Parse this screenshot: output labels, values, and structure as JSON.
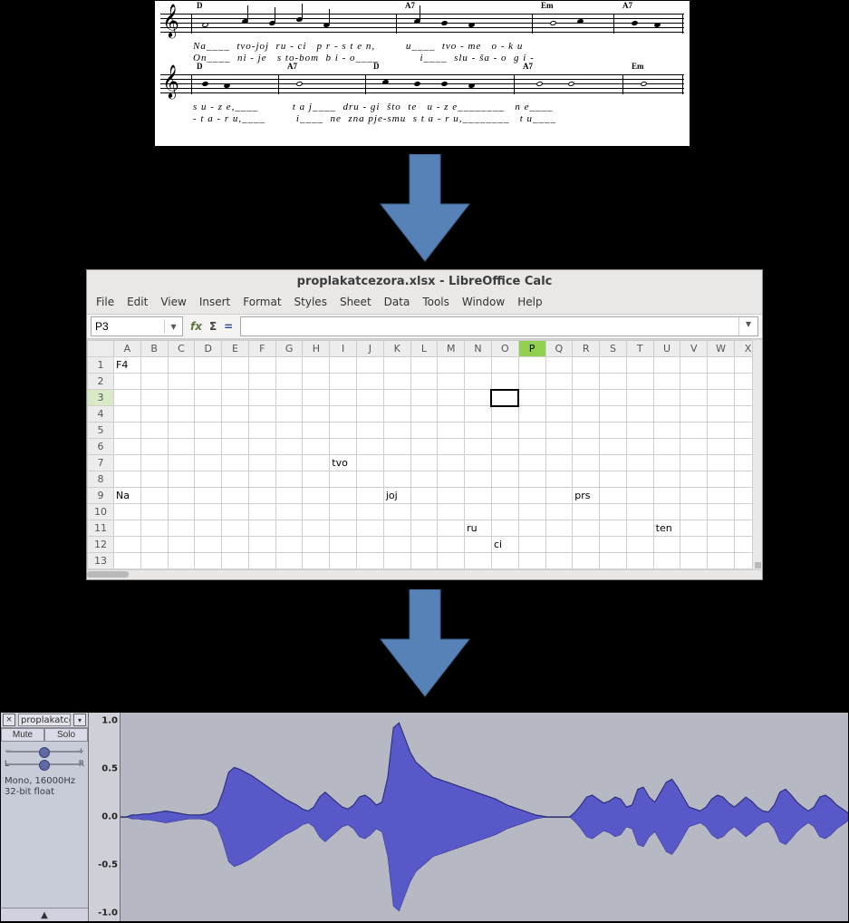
{
  "sheet_music": {
    "staff1": {
      "chords": [
        "D",
        "A7",
        "Em",
        "A7"
      ],
      "lyrics_line1": "Na____  tvo-joj  ru - ci   p r - s t e n,         u____  tvo - me   o - k u",
      "lyrics_line2": "On____  ni - je   s to-bom  b i - o____            i____  slu - ša - o  g i -"
    },
    "staff2": {
      "chords": [
        "D",
        "A7",
        "D",
        "A7",
        "Em"
      ],
      "lyrics_line1": "s u - z e,____          t a j____  dru - gi  što  te   u - z e________   n e____",
      "lyrics_line2": "- t a - r u,____         i____  ne  zna pje-smu  s t a - r u,________   t u____"
    }
  },
  "calc": {
    "title": "proplakatcezora.xlsx - LibreOffice Calc",
    "menu": [
      "File",
      "Edit",
      "View",
      "Insert",
      "Format",
      "Styles",
      "Sheet",
      "Data",
      "Tools",
      "Window",
      "Help"
    ],
    "cell_ref": "P3",
    "formula": "",
    "columns": [
      "A",
      "B",
      "C",
      "D",
      "E",
      "F",
      "G",
      "H",
      "I",
      "J",
      "K",
      "L",
      "M",
      "N",
      "O",
      "P",
      "Q",
      "R",
      "S",
      "T",
      "U",
      "V",
      "W",
      "X"
    ],
    "selected_col": "P",
    "selected_row": 3,
    "selected_cell": "O3",
    "rows": 13,
    "cells": {
      "A1": "F4",
      "I7": "tvo",
      "A9": "Na",
      "K9": "joj",
      "R9": "prs",
      "N11": "ru",
      "U11": "ten",
      "O12": "ci"
    },
    "highlight_ranges": [
      {
        "row": 7,
        "from": "I",
        "to": "J"
      },
      {
        "row": 9,
        "from": "A",
        "to": "I"
      },
      {
        "row": 9,
        "from": "K",
        "to": "L"
      },
      {
        "row": 9,
        "from": "R",
        "to": "U"
      },
      {
        "row": 11,
        "from": "N",
        "to": "O"
      },
      {
        "row": 11,
        "from": "U",
        "to": "X"
      },
      {
        "row": 12,
        "from": "O",
        "to": "P"
      }
    ]
  },
  "audacity": {
    "track_name": "proplakatcez",
    "mute": "Mute",
    "solo": "Solo",
    "gain": {
      "left": "−",
      "right": "+",
      "pos": 0.5
    },
    "pan": {
      "left": "L",
      "right": "R",
      "pos": 0.5
    },
    "info1": "Mono, 16000Hz",
    "info2": "32-bit float",
    "scale": [
      "1.0",
      "0.5",
      "0.0",
      "-0.5",
      "-1.0"
    ]
  }
}
